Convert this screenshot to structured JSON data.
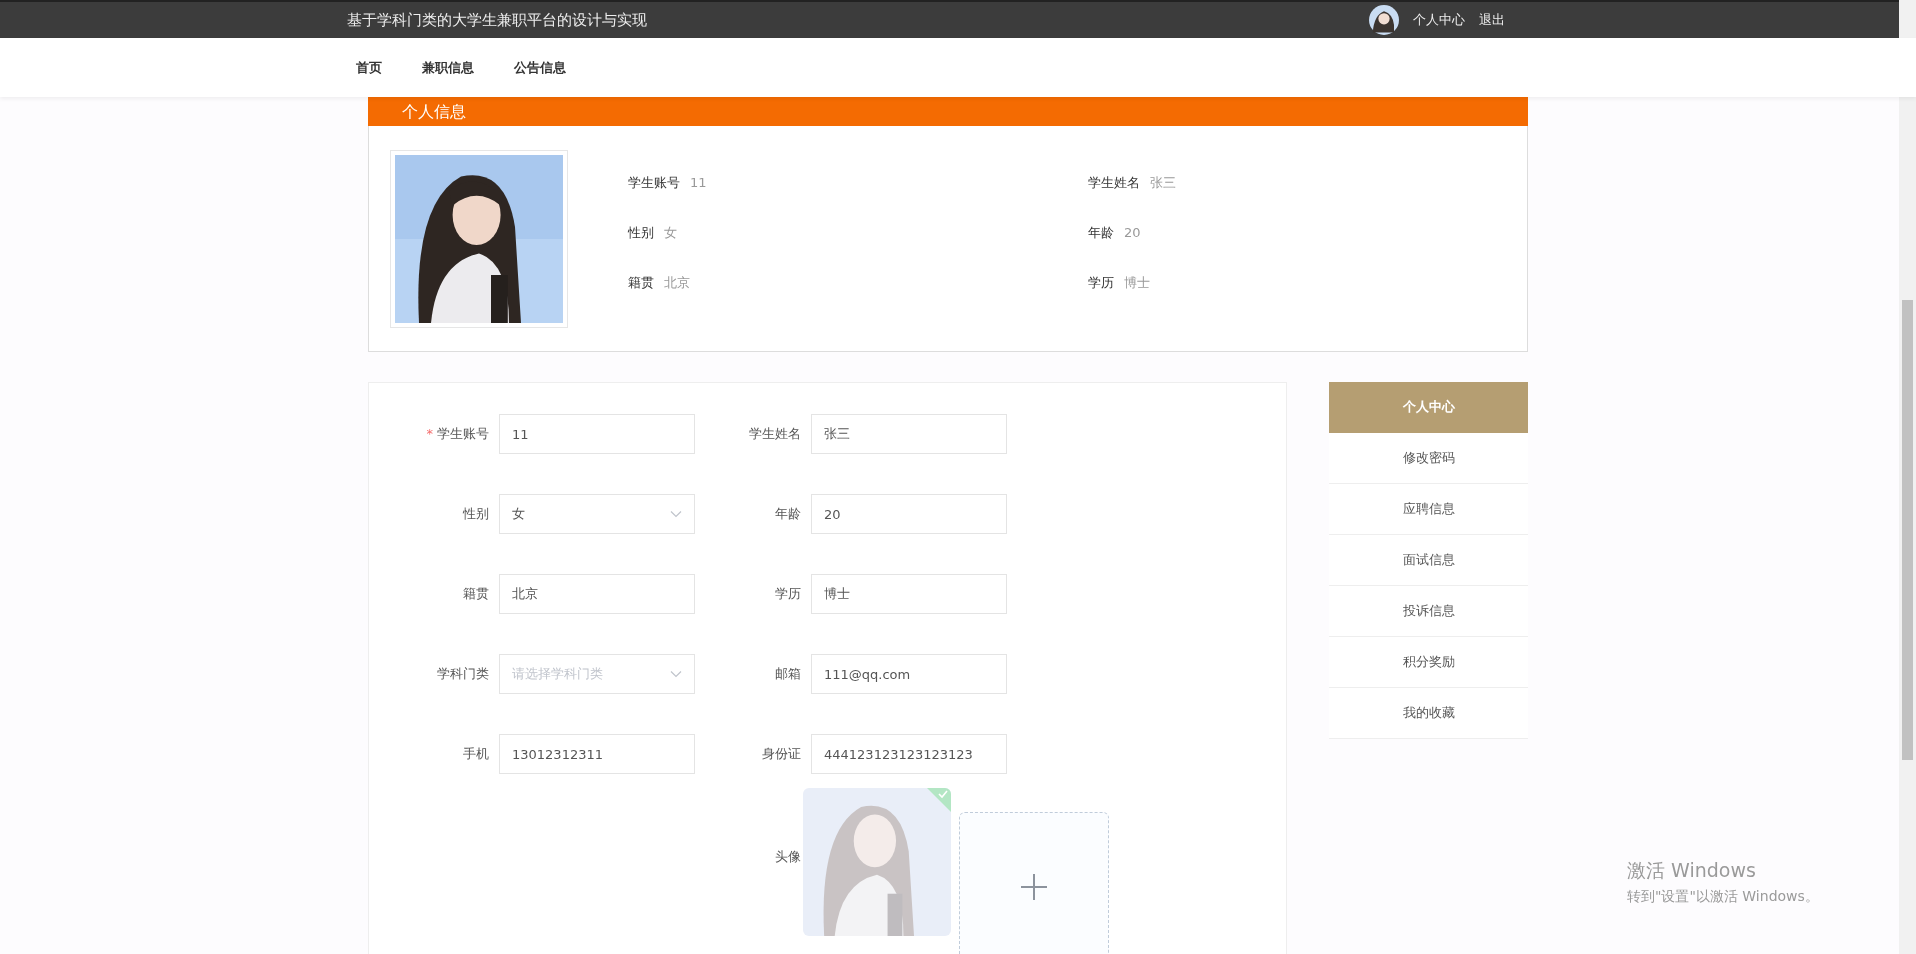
{
  "top_bar": {
    "title": "基于学科门类的大学生兼职平台的设计与实现",
    "links": [
      "个人中心",
      "退出"
    ]
  },
  "nav": {
    "items": [
      "首页",
      "兼职信息",
      "公告信息"
    ]
  },
  "profile": {
    "title": "个人信息",
    "fields": [
      {
        "label": "学生账号",
        "value": "11"
      },
      {
        "label": "学生姓名",
        "value": "张三"
      },
      {
        "label": "性别",
        "value": "女"
      },
      {
        "label": "年龄",
        "value": "20"
      },
      {
        "label": "籍贯",
        "value": "北京"
      },
      {
        "label": "学历",
        "value": "博士"
      }
    ]
  },
  "form": {
    "fields": [
      {
        "label": "学生账号",
        "kind": "input",
        "required_mark": "*",
        "value": "11"
      },
      {
        "label": "学生姓名",
        "kind": "input",
        "value": "张三"
      },
      {
        "label": "性别",
        "kind": "select",
        "value": "女"
      },
      {
        "label": "年龄",
        "kind": "input",
        "value": "20"
      },
      {
        "label": "籍贯",
        "kind": "input",
        "value": "北京"
      },
      {
        "label": "学历",
        "kind": "input",
        "value": "博士"
      },
      {
        "label": "学科门类",
        "kind": "select",
        "placeholder": "请选择学科门类"
      },
      {
        "label": "邮箱",
        "kind": "input",
        "value": "111@qq.com"
      },
      {
        "label": "手机",
        "kind": "input",
        "value": "13012312311"
      },
      {
        "label": "身份证",
        "kind": "input",
        "value": "444123123123123123"
      }
    ],
    "avatar": {
      "label": "头像",
      "uploaded": true
    }
  },
  "sidebar": {
    "items": [
      {
        "label": "个人中心",
        "selected": true
      },
      {
        "label": "修改密码",
        "selected": false
      },
      {
        "label": "应聘信息",
        "selected": false
      },
      {
        "label": "面试信息",
        "selected": false
      },
      {
        "label": "投诉信息",
        "selected": false
      },
      {
        "label": "积分奖励",
        "selected": false
      },
      {
        "label": "我的收藏",
        "selected": false
      }
    ]
  },
  "os_notice": {
    "title": "激活 Windows",
    "subtitle": "转到\"设置\"以激活 Windows。"
  }
}
